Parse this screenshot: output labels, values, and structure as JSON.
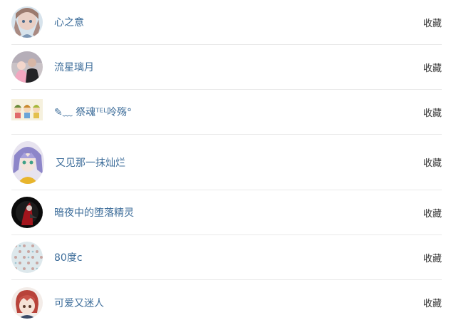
{
  "users": [
    {
      "name": "心之意",
      "action": "收藏",
      "avatar_icon": "girl-anime-avatar-icon"
    },
    {
      "name": "流星璃月",
      "action": "收藏",
      "avatar_icon": "family-photo-avatar-icon"
    },
    {
      "name": "✎﹏ 祭魂ᵀᴱᴸ呤殇°",
      "action": "收藏",
      "avatar_icon": "children-cartoon-avatar-icon"
    },
    {
      "name": "又见那一抹灿烂",
      "action": "收藏",
      "avatar_icon": "purple-hair-anime-avatar-icon"
    },
    {
      "name": "暗夜中的堕落精灵",
      "action": "收藏",
      "avatar_icon": "dark-red-figure-avatar-icon"
    },
    {
      "name": "80度c",
      "action": "收藏",
      "avatar_icon": "pattern-avatar-icon"
    },
    {
      "name": "可爱又迷人",
      "action": "收藏",
      "avatar_icon": "red-hair-anime-avatar-icon"
    }
  ],
  "colors": {
    "name": "#3d6d9a",
    "action": "#333333",
    "divider": "#e9e9e9"
  }
}
